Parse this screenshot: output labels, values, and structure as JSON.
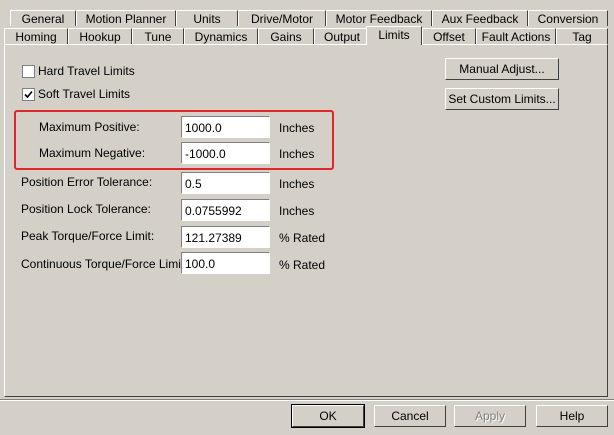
{
  "tabs_row1": [
    {
      "label": "General"
    },
    {
      "label": "Motion Planner"
    },
    {
      "label": "Units"
    },
    {
      "label": "Drive/Motor"
    },
    {
      "label": "Motor Feedback"
    },
    {
      "label": "Aux Feedback"
    },
    {
      "label": "Conversion"
    }
  ],
  "tabs_row2": [
    {
      "label": "Homing"
    },
    {
      "label": "Hookup"
    },
    {
      "label": "Tune"
    },
    {
      "label": "Dynamics"
    },
    {
      "label": "Gains"
    },
    {
      "label": "Output"
    },
    {
      "label": "Limits"
    },
    {
      "label": "Offset"
    },
    {
      "label": "Fault Actions"
    },
    {
      "label": "Tag"
    }
  ],
  "active_tab": "Limits",
  "limits": {
    "hard_travel": {
      "label": "Hard Travel Limits",
      "checked": false
    },
    "soft_travel": {
      "label": "Soft Travel Limits",
      "checked": true
    },
    "manual_adjust_label": "Manual Adjust...",
    "set_custom_label": "Set Custom Limits...",
    "max_positive": {
      "label": "Maximum Positive:",
      "value": "1000.0",
      "unit": "Inches"
    },
    "max_negative": {
      "label": "Maximum Negative:",
      "value": "-1000.0",
      "unit": "Inches"
    },
    "pos_error_tol": {
      "label": "Position Error Tolerance:",
      "value": "0.5",
      "unit": "Inches"
    },
    "pos_lock_tol": {
      "label": "Position Lock Tolerance:",
      "value": "0.0755992",
      "unit": "Inches"
    },
    "peak_torque": {
      "label": "Peak Torque/Force Limit:",
      "value": "121.27389",
      "unit": "% Rated"
    },
    "cont_torque": {
      "label": "Continuous Torque/Force Limit:",
      "value": "100.0",
      "unit": "% Rated"
    }
  },
  "footer": {
    "ok_label": "OK",
    "cancel_label": "Cancel",
    "apply_label": "Apply",
    "help_label": "Help"
  },
  "colors": {
    "highlight_box": "#e0262b",
    "dialog_face": "#d4d0c8"
  }
}
